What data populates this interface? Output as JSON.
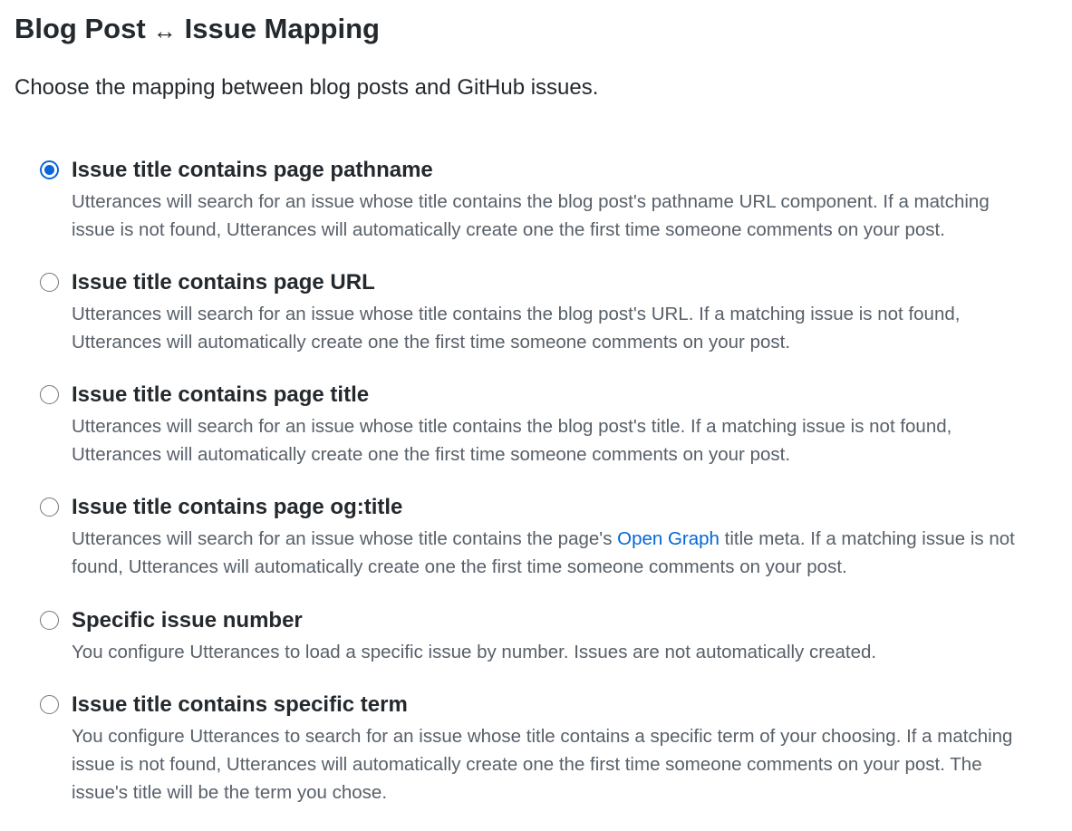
{
  "header": {
    "title_left": "Blog Post",
    "title_arrow": "↔",
    "title_right": "Issue Mapping",
    "intro": "Choose the mapping between blog posts and GitHub issues."
  },
  "options": [
    {
      "label": "Issue title contains page pathname",
      "selected": true,
      "description": "Utterances will search for an issue whose title contains the blog post's pathname URL component. If a matching issue is not found, Utterances will automatically create one the first time someone comments on your post."
    },
    {
      "label": "Issue title contains page URL",
      "selected": false,
      "description": "Utterances will search for an issue whose title contains the blog post's URL. If a matching issue is not found, Utterances will automatically create one the first time someone comments on your post."
    },
    {
      "label": "Issue title contains page title",
      "selected": false,
      "description": "Utterances will search for an issue whose title contains the blog post's title. If a matching issue is not found, Utterances will automatically create one the first time someone comments on your post."
    },
    {
      "label": "Issue title contains page og:title",
      "selected": false,
      "description_before": "Utterances will search for an issue whose title contains the page's ",
      "description_link": "Open Graph",
      "description_after": " title meta. If a matching issue is not found, Utterances will automatically create one the first time someone comments on your post."
    },
    {
      "label": "Specific issue number",
      "selected": false,
      "description": "You configure Utterances to load a specific issue by number. Issues are not automatically created."
    },
    {
      "label": "Issue title contains specific term",
      "selected": false,
      "description": "You configure Utterances to search for an issue whose title contains a specific term of your choosing. If a matching issue is not found, Utterances will automatically create one the first time someone comments on your post. The issue's title will be the term you chose."
    }
  ],
  "colors": {
    "accent": "#0a66d8",
    "link": "#0366d6",
    "text": "#24292e",
    "muted": "#586069"
  }
}
